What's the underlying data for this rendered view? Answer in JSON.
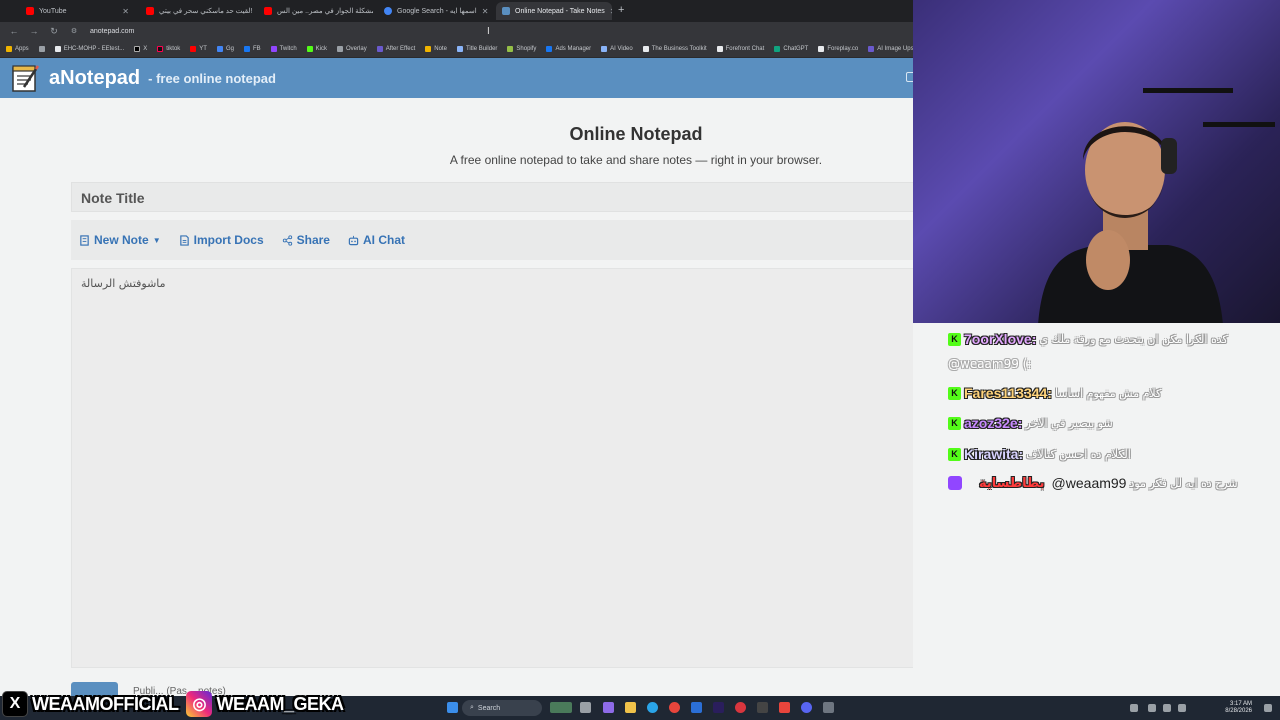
{
  "browser": {
    "tabs": [
      {
        "label": "YouTube",
        "color": "#ff0000",
        "active": false
      },
      {
        "label": "لقيت حد ماسكني سحر في بيتي!",
        "color": "#ff0000",
        "active": false
      },
      {
        "label": "مشكلة الجواز في مصر.. مين الس...",
        "color": "#ff0000",
        "active": false
      },
      {
        "label": "Google Search - اسمها ايه",
        "color": "#4285f4",
        "active": false
      },
      {
        "label": "Online Notepad - Take Notes",
        "color": "#5a8fc0",
        "active": true
      }
    ],
    "url": "anotepad.com",
    "bookmarks": [
      "Apps",
      "EHC-MOHP - EEtest...",
      "X",
      "tiktok",
      "YT",
      "Gg",
      "FB",
      "Twitch",
      "Kick",
      "Overlay",
      "After Effect",
      "Note",
      "Title Builder",
      "Shopify",
      "Ads Manager",
      "AI Video",
      "The Business Toolkit",
      "Forefront Chat",
      "ChatGPT",
      "Foreplay.co",
      "AI Image Ups..."
    ]
  },
  "site": {
    "logo": "aNotepad",
    "tagline": "- free online notepad"
  },
  "page": {
    "title": "Online Notepad",
    "subtitle": "A free online notepad to take and share notes — right in your browser.",
    "note_title_placeholder": "Note Title",
    "toolbar": {
      "new_note": "New Note",
      "import_docs": "Import Docs",
      "share": "Share",
      "ai_chat": "AI Chat"
    },
    "editor_text": "ماشوفتش الرسالة",
    "bottom_partial": "Publi... (Pas... notes)"
  },
  "chat": {
    "messages": [
      {
        "user": "7oorXlove:",
        "color": "#e3a8ff",
        "text": "كده الكرا مكن ان يتحدث مع ورقة ملك ي"
      },
      {
        "user": "Fares113344:",
        "color": "#ffd37a",
        "text": "كلام مش مفهوم اساسا"
      },
      {
        "user": "azoz32e:",
        "color": "#c88bff",
        "text": "شو بيصير في الاخر"
      },
      {
        "user": "Kirawita:",
        "color": "#d7d2ff",
        "text": "الكلام ده احسن كتالاف"
      }
    ],
    "continuation": "@weaam99 (:",
    "twitch_user": "بطاطساية",
    "twitch_mention": "@weaam99",
    "twitch_text": "شرح ده ايه لل فكر مود"
  },
  "taskbar": {
    "search": "Search",
    "time": "3:17 AM",
    "date": "8/28/2026"
  },
  "social": {
    "x_handle": "WEAAMOFFICIAL",
    "ig_handle": "WEAAM_GEKA"
  },
  "colors": {
    "header": "#5a8fc0",
    "link": "#3773b5",
    "kick": "#53fc18",
    "twitch": "#9146ff"
  }
}
